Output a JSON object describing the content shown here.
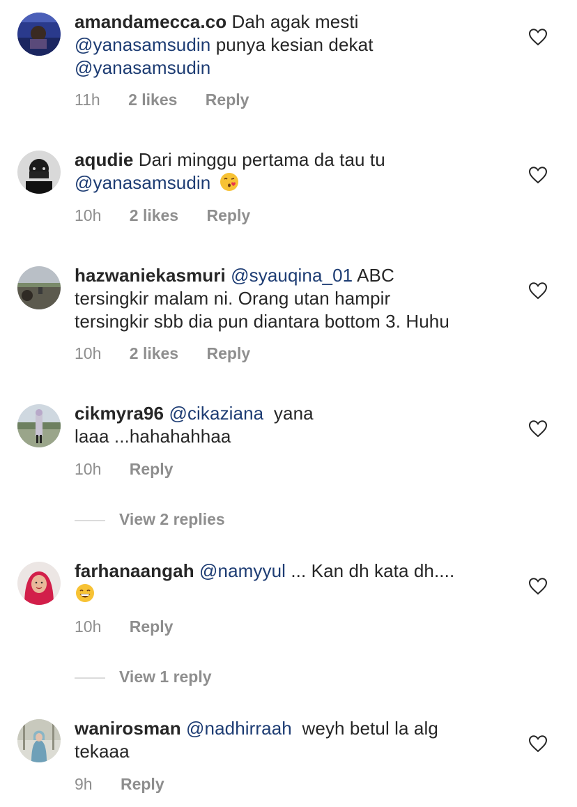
{
  "comments": [
    {
      "username": "amandamecca.co",
      "text_parts": [
        "Dah agak mesti",
        "@yanasamsudin",
        "punya kesian dekat",
        "@yanasamsudin"
      ],
      "time": "11h",
      "likes": "2 likes",
      "reply": "Reply"
    },
    {
      "username": "aqudie",
      "text_parts": [
        "Dari minggu pertama da tau tu",
        "@yanasamsudin"
      ],
      "emoji": "kissing-face-emoji",
      "time": "10h",
      "likes": "2 likes",
      "reply": "Reply"
    },
    {
      "username": "hazwaniekasmuri",
      "text_parts": [
        "@syauqina_01",
        "ABC",
        "tersingkir malam ni. Orang utan hampir",
        "tersingkir sbb dia pun diantara bottom 3. Huhu"
      ],
      "time": "10h",
      "likes": "2 likes",
      "reply": "Reply"
    },
    {
      "username": "cikmyra96",
      "text_parts": [
        "@cikaziana",
        "yana",
        "laaa ...hahahahhaa"
      ],
      "time": "10h",
      "reply": "Reply",
      "view_replies": "View 2 replies"
    },
    {
      "username": "farhanaangah",
      "text_parts": [
        "@namyyul",
        "... Kan dh kata dh...."
      ],
      "emoji": "grinning-face-emoji",
      "time": "10h",
      "reply": "Reply",
      "view_replies": "View 1 reply"
    },
    {
      "username": "wanirosman",
      "text_parts": [
        "@nadhirraah",
        "weyh betul la alg",
        "tekaaa"
      ],
      "time": "9h",
      "reply": "Reply"
    }
  ],
  "icons": {
    "like": "heart-outline-icon"
  },
  "colors": {
    "mention": "#1d3c73",
    "meta": "#8e8e8e",
    "text": "#262626"
  }
}
